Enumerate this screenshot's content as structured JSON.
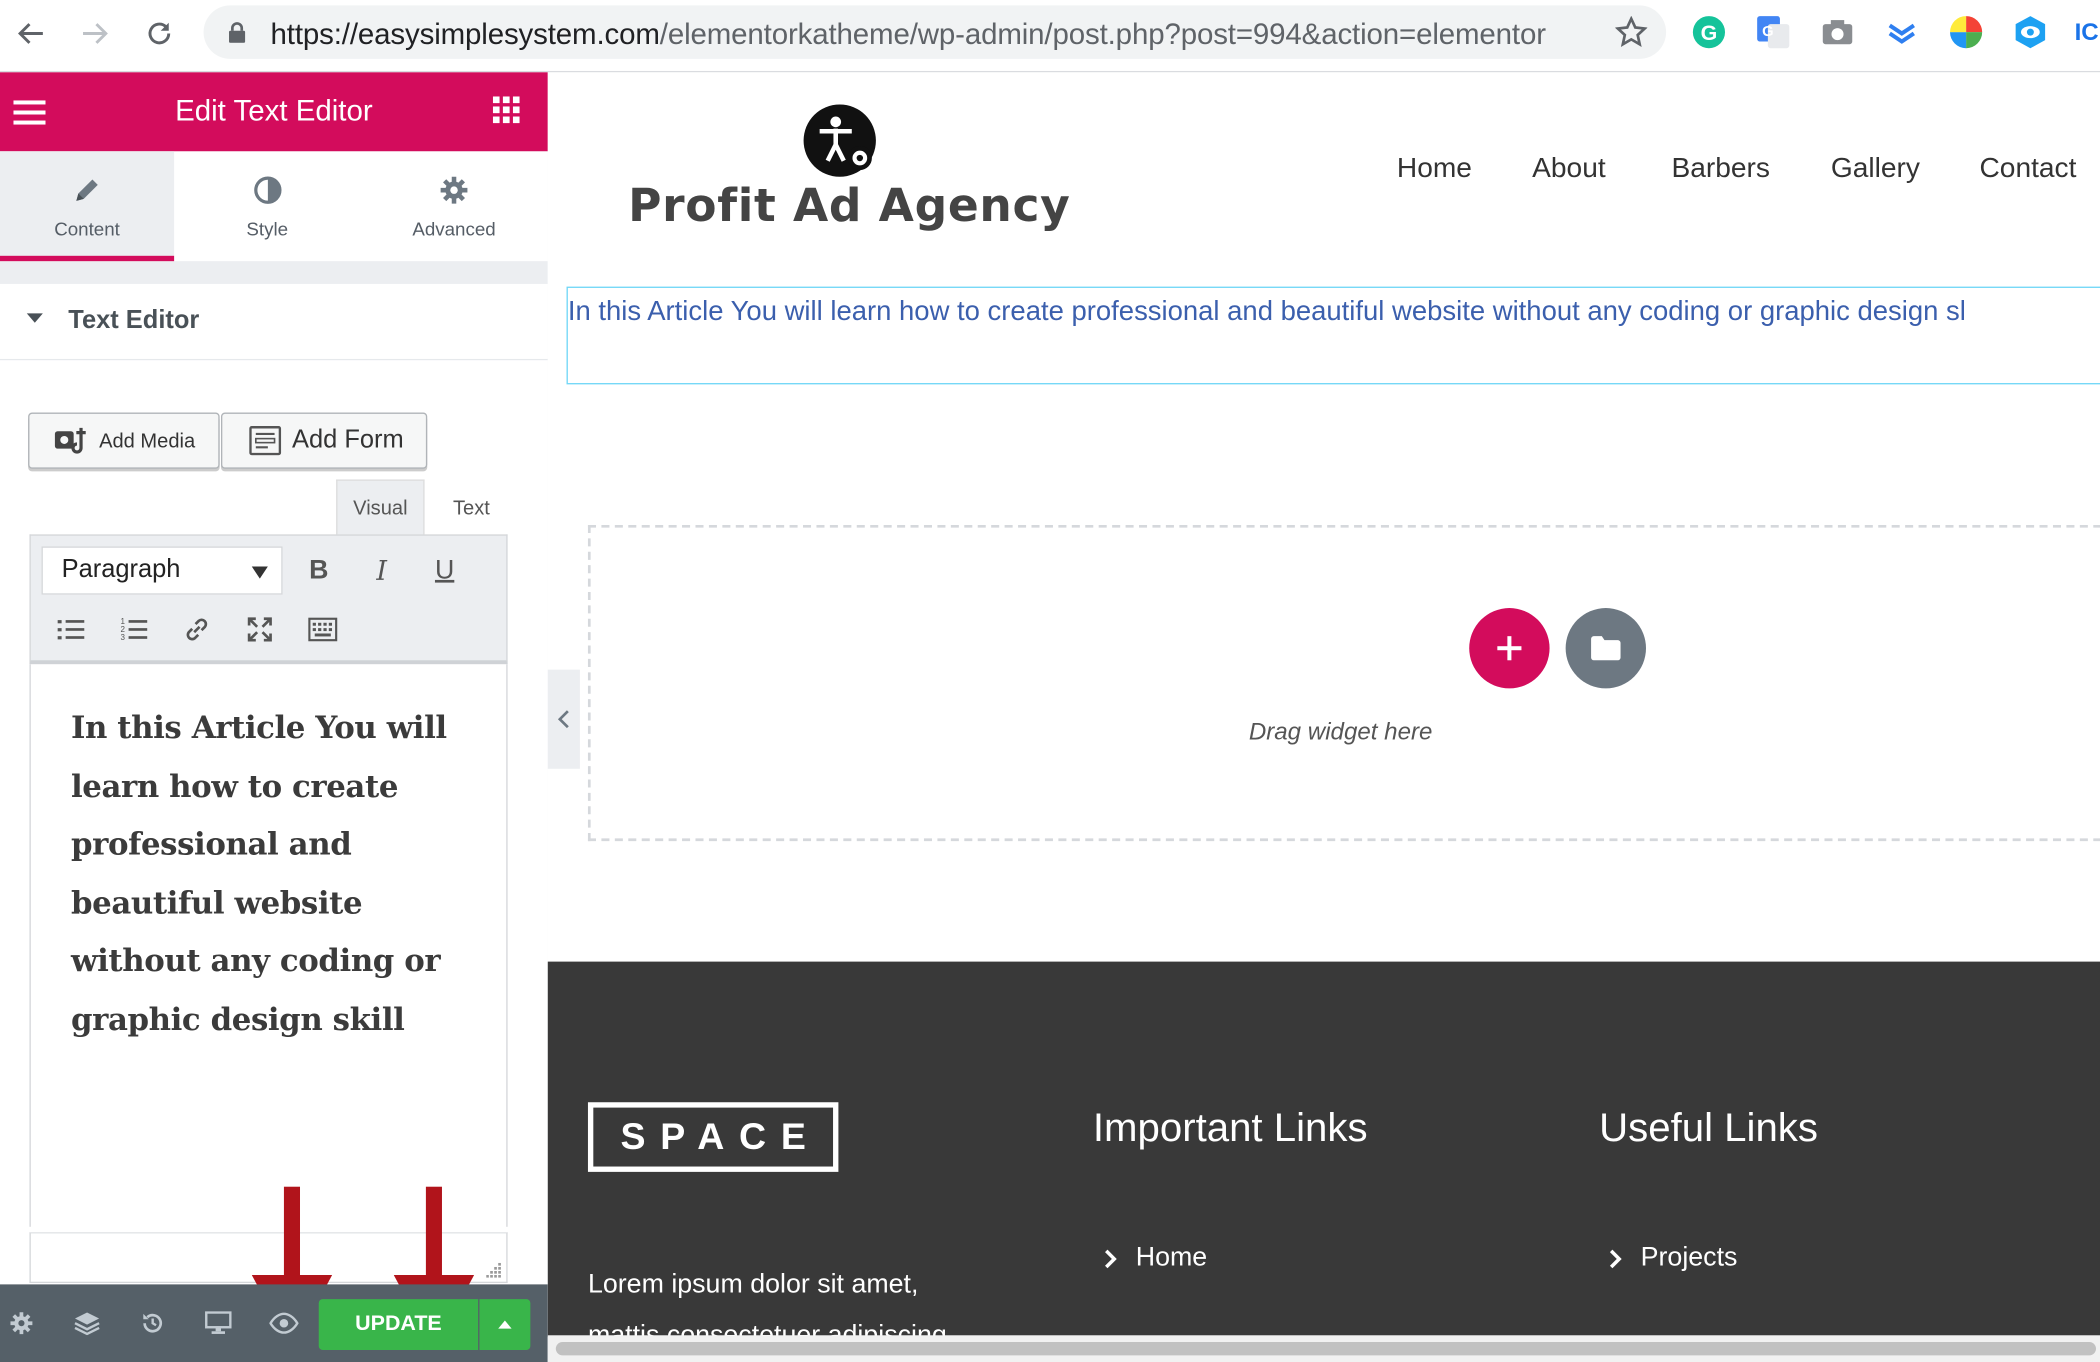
{
  "browser": {
    "url_host": "https://easysimplesystem.com",
    "url_path": "/elementorkatheme/wp-admin/post.php?post=994&action=elementor"
  },
  "panel": {
    "title": "Edit Text Editor",
    "tabs": [
      {
        "label": "Content",
        "icon": "pencil-icon"
      },
      {
        "label": "Style",
        "icon": "contrast-icon"
      },
      {
        "label": "Advanced",
        "icon": "gear-icon"
      }
    ],
    "section_title": "Text Editor",
    "add_media_label": "Add Media",
    "add_form_label": "Add Form",
    "mode_visual": "Visual",
    "mode_text": "Text",
    "format_select": "Paragraph",
    "editor_content": "In this Article You will learn how to create professional and beautiful website without any coding or graphic design skill",
    "update_label": "UPDATE",
    "accent_color": "#d30c5c",
    "update_color": "#39b54a"
  },
  "site": {
    "logo_text": "Profit Ad Agency",
    "nav": [
      "Home",
      "About",
      "Barbers",
      "Gallery",
      "Contact"
    ],
    "text_widget": "In this Article You will learn how to create professional and beautiful website without any coding or graphic design sl",
    "drag_text": "Drag widget here",
    "footer": {
      "logo": "SPACE",
      "lorem_line1": "Lorem ipsum dolor sit amet,",
      "lorem_line2": "mattis consectetuer adipiscing",
      "important_links_title": "Important Links",
      "important_link_1": "Home",
      "useful_links_title": "Useful Links",
      "useful_link_1": "Projects"
    }
  }
}
